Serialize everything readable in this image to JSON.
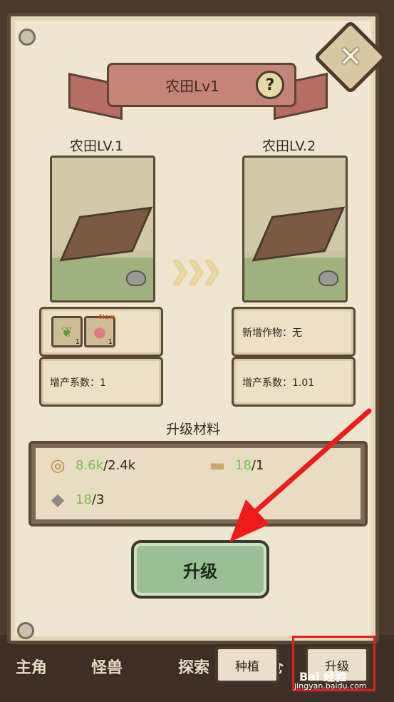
{
  "window": {
    "title": "农田Lv1"
  },
  "current": {
    "level_label": "农田LV.1",
    "items": [
      {
        "icon": "bean-pod-icon",
        "count": "1",
        "new": ""
      },
      {
        "icon": "meat-icon",
        "count": "1",
        "new": "New"
      }
    ],
    "yield": "增产系数：1"
  },
  "next": {
    "level_label": "农田LV.2",
    "new_crops": "新增作物：无",
    "yield": "增产系数：1.01"
  },
  "materials": {
    "title": "升级材料",
    "coins": {
      "have": "8.6k",
      "need": "/2.4k"
    },
    "wood": {
      "have": "18",
      "need": "/1"
    },
    "stone": {
      "have": "18",
      "need": "/3"
    }
  },
  "upgrade_button": "升级",
  "tabs": {
    "plant": "种植",
    "upgrade": "升级"
  },
  "bg_nav": [
    "主角",
    "怪兽",
    "探索",
    "仓"
  ],
  "help": "?",
  "close": "✕",
  "arrows": "❯❯❯",
  "watermark": {
    "logo": "Bai 经验",
    "url": "jingyan.baidu.com"
  },
  "colors": {
    "accent_green": "#7cbd52",
    "highlight": "#e02020",
    "ribbon": "#c4847a"
  }
}
